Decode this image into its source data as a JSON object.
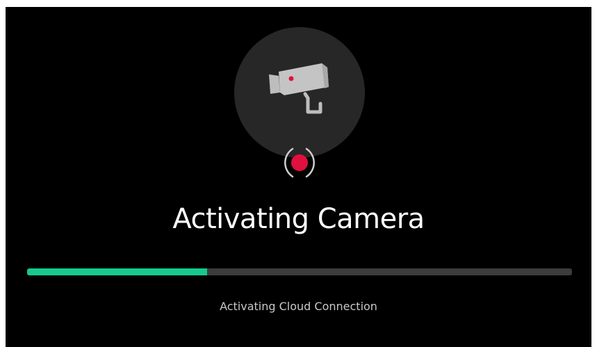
{
  "screen": {
    "title": "Activating Camera",
    "status_text": "Activating Cloud Connection",
    "icons": {
      "camera": "security-camera-icon",
      "record": "record-indicator-icon"
    }
  },
  "progress": {
    "fraction": 0.33
  },
  "colors": {
    "background": "#000000",
    "circle": "#272727",
    "accent_green": "#16c98d",
    "record_red": "#e0103f",
    "track": "#3c3c3c"
  }
}
